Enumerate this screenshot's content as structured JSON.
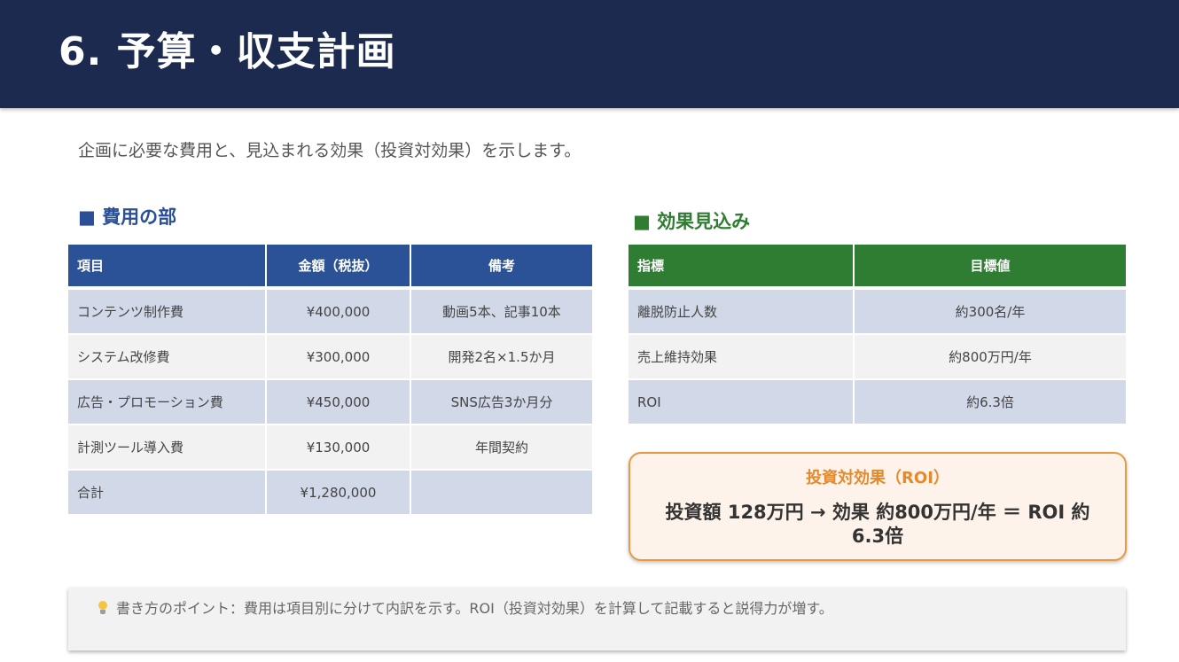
{
  "header": {
    "title": "6. 予算・収支計画"
  },
  "intro": "企画に必要な費用と、見込まれる効果（投資対効果）を示します。",
  "cost": {
    "title": "■ 費用の部",
    "columns": [
      "項目",
      "金額（税抜）",
      "備考"
    ],
    "rows": [
      [
        "コンテンツ制作費",
        "¥400,000",
        "動画5本、記事10本"
      ],
      [
        "システム改修費",
        "¥300,000",
        "開発2名×1.5か月"
      ],
      [
        "広告・プロモーション費",
        "¥450,000",
        "SNS広告3か月分"
      ],
      [
        "計測ツール導入費",
        "¥130,000",
        "年間契約"
      ],
      [
        "合計",
        "¥1,280,000",
        ""
      ]
    ]
  },
  "effect": {
    "title": "■ 効果見込み",
    "columns": [
      "指標",
      "目標値"
    ],
    "rows": [
      [
        "離脱防止人数",
        "約300名/年"
      ],
      [
        "売上維持効果",
        "約800万円/年"
      ],
      [
        "ROI",
        "約6.3倍"
      ]
    ]
  },
  "roi": {
    "title": "投資対効果（ROI）",
    "body": "投資額 128万円 → 効果 約800万円/年 ＝ ROI 約6.3倍"
  },
  "tip": {
    "icon": "lightbulb-icon",
    "text": "書き方のポイント：費用は項目別に分けて内訳を示す。ROI（投資対効果）を計算して記載すると説得力が増す。"
  },
  "colors": {
    "header_bg": "#1b2a4e",
    "cost_accent": "#2b5297",
    "effect_accent": "#2e7d32",
    "roi_accent": "#e5892f"
  }
}
